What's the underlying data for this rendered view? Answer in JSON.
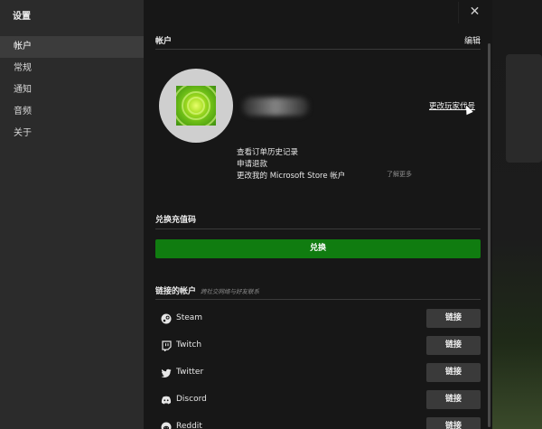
{
  "app": {
    "title": "设置",
    "close_glyph": "✕"
  },
  "sidebar": {
    "items": [
      {
        "label": "帐户",
        "active": true
      },
      {
        "label": "常规",
        "active": false
      },
      {
        "label": "通知",
        "active": false
      },
      {
        "label": "音频",
        "active": false
      },
      {
        "label": "关于",
        "active": false
      }
    ]
  },
  "account": {
    "heading": "帐户",
    "edit_label": "编辑",
    "change_gamertag": "更改玩家代号",
    "links": {
      "order_history": "查看订单历史记录",
      "refund": "申请退款",
      "change_ms_account": "更改我的 Microsoft Store 帐户"
    },
    "learn_more": "了解更多"
  },
  "redeem": {
    "heading": "兑换充值码",
    "button_label": "兑换"
  },
  "linked_accounts": {
    "heading": "链接的帐户",
    "subtitle": "跨社交网络与好友联系",
    "services": [
      {
        "name": "Steam",
        "icon": "steam-icon",
        "button": "链接"
      },
      {
        "name": "Twitch",
        "icon": "twitch-icon",
        "button": "链接"
      },
      {
        "name": "Twitter",
        "icon": "twitter-icon",
        "button": "链接"
      },
      {
        "name": "Discord",
        "icon": "discord-icon",
        "button": "链接"
      },
      {
        "name": "Reddit",
        "icon": "reddit-icon",
        "button": "链接"
      }
    ]
  },
  "colors": {
    "accent": "#107c10",
    "sidebar_bg": "#2b2b2b",
    "panel_bg": "#171717",
    "button_bg": "#3a3a3a"
  }
}
